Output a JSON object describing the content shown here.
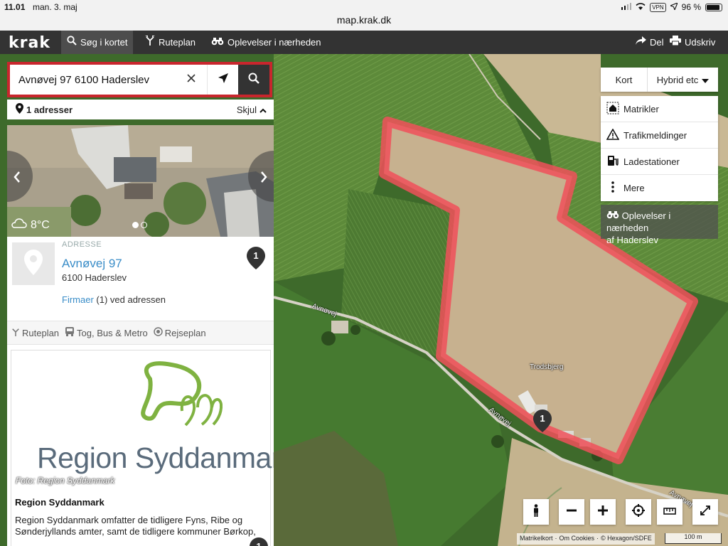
{
  "status": {
    "time": "11.01",
    "date": "man. 3. maj",
    "battery": "96 %",
    "vpn": "VPN"
  },
  "url": "map.krak.dk",
  "nav": {
    "logo": "krak",
    "items": [
      {
        "label": "Søg i kortet"
      },
      {
        "label": "Ruteplan"
      },
      {
        "label": "Oplevelser i nærheden"
      }
    ],
    "share": "Del",
    "print": "Udskriv"
  },
  "search": {
    "value": "Avnøvej 97 6100 Haderslev"
  },
  "results": {
    "count": "1 adresser",
    "hide": "Skjul"
  },
  "photo": {
    "temp": "8°C"
  },
  "address": {
    "type_label": "ADRESSE",
    "street": "Avnøvej 97",
    "city": "6100 Haderslev",
    "firms_link": "Firmaer",
    "firms_rest": " (1) ved adressen",
    "marker": "1"
  },
  "actions": {
    "route": "Ruteplan",
    "transit": "Tog, Bus & Metro",
    "journey": "Rejseplan"
  },
  "card": {
    "brand": "Region Syddanmark",
    "photo_credit": "Foto: Region Syddanmark",
    "title": "Region Syddanmark",
    "description": "Region Syddanmark omfatter de tidligere Fyns, Ribe og Sønderjyllands amter, samt de tidligere kommuner Børkop,",
    "marker": "1"
  },
  "maptype": {
    "kort": "Kort",
    "hybrid": "Hybrid etc"
  },
  "layers": [
    {
      "label": "Matrikler",
      "icon": "house-icon"
    },
    {
      "label": "Trafikmeldinger",
      "icon": "warning-icon"
    },
    {
      "label": "Ladestationer",
      "icon": "charging-station-icon"
    },
    {
      "label": "Mere",
      "icon": "more-vertical-icon"
    }
  ],
  "nearby": {
    "line1": "Oplevelser i nærheden",
    "line2": "af Haderslev"
  },
  "map_labels": {
    "road1": "Avnøvej",
    "road2": "Avnøvej",
    "road3": "Avnøvej",
    "place": "Trodsbjerg",
    "marker": "1"
  },
  "attribution": {
    "matrikel": "Matrikelkort",
    "cookies": "Om Cookies",
    "copyright": "© Hexagon/SDFE",
    "scale": "100 m"
  },
  "colors": {
    "accent_red": "#c8262d",
    "link_blue": "#3a8dc8",
    "nav_dark": "#333333",
    "parcel_outline": "#f0505a"
  }
}
